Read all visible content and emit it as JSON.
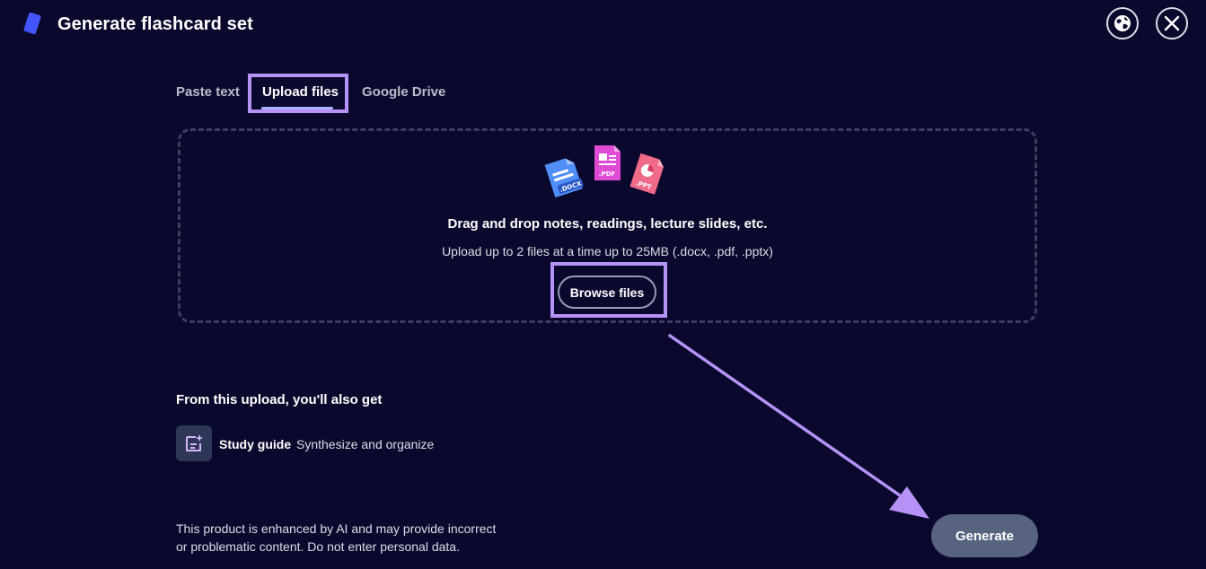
{
  "header": {
    "title": "Generate flashcard set",
    "icons": [
      "logo-icon",
      "globe-icon",
      "close-icon"
    ]
  },
  "tabs": [
    {
      "label": "Paste text",
      "active": false
    },
    {
      "label": "Upload files",
      "active": true
    },
    {
      "label": "Google Drive",
      "active": false
    }
  ],
  "dropzone": {
    "file_icons": [
      ".DOCX",
      ".PDF",
      ".PPT"
    ],
    "title": "Drag and drop notes, readings, lecture slides, etc.",
    "subtitle": "Upload up to 2 files at a time up to 25MB (.docx, .pdf, .pptx)",
    "browse_label": "Browse files"
  },
  "also_get": {
    "title": "From this upload, you'll also get",
    "item_label": "Study guide",
    "item_desc": "Synthesize and organize"
  },
  "disclaimer": {
    "line1": "This product is enhanced by AI and may provide incorrect",
    "line2": "or problematic content. Do not enter personal data."
  },
  "generate_label": "Generate",
  "colors": {
    "background": "#0a092d",
    "highlight": "#b692f6",
    "tab_underline": "#a8b1ff",
    "generate_bg": "#586380",
    "docx": "#4f8ff7",
    "pdf": "#e04bd6",
    "ppt": "#f06a8a"
  }
}
